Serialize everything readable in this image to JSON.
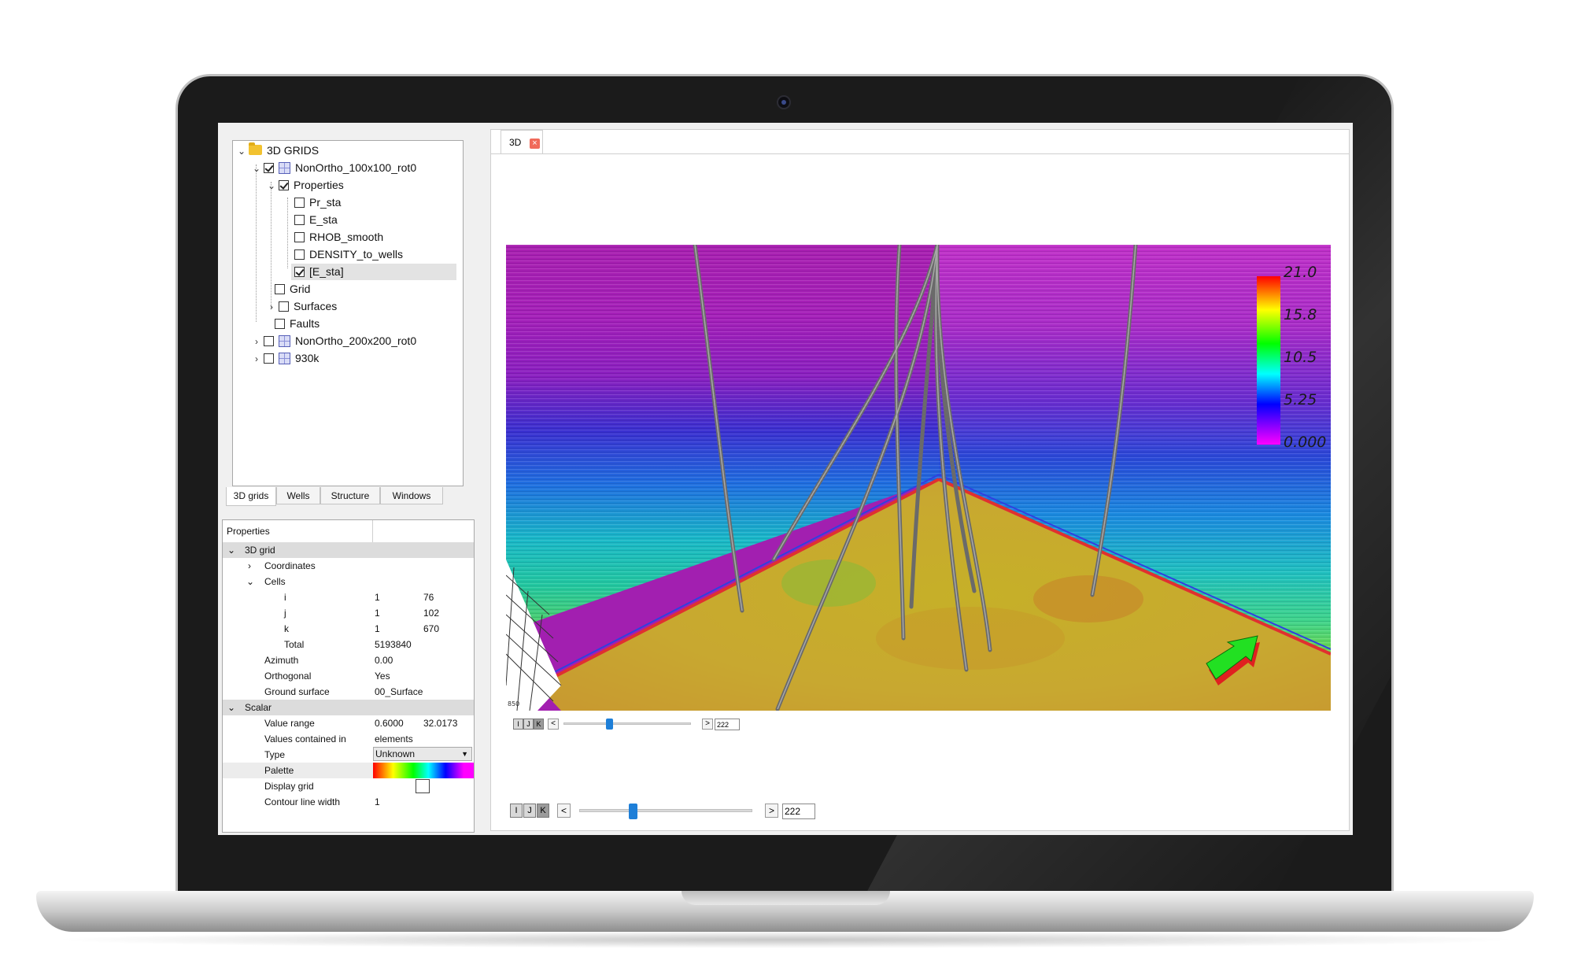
{
  "tree": {
    "root": "3D GRIDS",
    "grid1": "NonOrtho_100x100_rot0",
    "properties": "Properties",
    "items": [
      "Pr_sta",
      "E_sta",
      "RHOB_smooth",
      "DENSITY_to_wells",
      "[E_sta]"
    ],
    "grid": "Grid",
    "surfaces": "Surfaces",
    "faults": "Faults",
    "grid2": "NonOrtho_200x200_rot0",
    "grid3": "930k"
  },
  "tabs": [
    "3D grids",
    "Wells",
    "Structure",
    "Windows"
  ],
  "props": {
    "header": "Properties",
    "group1": "3D grid",
    "coordinates": "Coordinates",
    "cells": "Cells",
    "i_label": "i",
    "i_min": "1",
    "i_max": "76",
    "j_label": "j",
    "j_min": "1",
    "j_max": "102",
    "k_label": "k",
    "k_min": "1",
    "k_max": "670",
    "total_label": "Total",
    "total_value": "5193840",
    "azimuth_label": "Azimuth",
    "azimuth_value": "0.00",
    "orthogonal_label": "Orthogonal",
    "orthogonal_value": "Yes",
    "ground_label": "Ground surface",
    "ground_value": "00_Surface",
    "group2": "Scalar",
    "range_label": "Value range",
    "range_min": "0.6000",
    "range_max": "32.0173",
    "contained_label": "Values contained in",
    "contained_value": "elements",
    "type_label": "Type",
    "type_value": "Unknown",
    "palette_label": "Palette",
    "display_grid_label": "Display grid",
    "contour_label": "Contour line width",
    "contour_value": "1"
  },
  "view": {
    "tab": "3D",
    "close_icon": "close-icon",
    "legend": [
      "21.0",
      "15.8",
      "10.5",
      "5.25",
      "0.000"
    ],
    "axis_tick": "850",
    "slider_inner": {
      "i": "I",
      "j": "J",
      "k": "K",
      "prev": "<",
      "next": ">",
      "value": "222"
    },
    "slider_outer": {
      "i": "I",
      "j": "J",
      "k": "K",
      "prev": "<",
      "next": ">",
      "value": "222"
    }
  },
  "colors": {
    "palette_start": "#ff0000",
    "palette_end": "#ff00ff",
    "close": "#f06a5a",
    "slider": "#1e7fd8"
  }
}
